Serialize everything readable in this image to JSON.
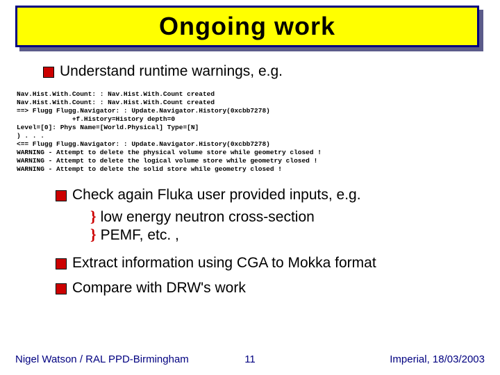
{
  "title": "Ongoing work",
  "bullets": {
    "b1": "Understand runtime warnings, e.g.",
    "b2": "Check again Fluka user provided inputs, e.g.",
    "b2a": "low energy neutron cross-section",
    "b2b": "PEMF, etc. ,",
    "b3": "Extract information using CGA to Mokka format",
    "b4": "Compare with DRW's work"
  },
  "code": "Nav.Hist.With.Count: : Nav.Hist.With.Count created\nNav.Hist.With.Count: : Nav.Hist.With.Count created\n==> Flugg Flugg.Navigator: : Update.Navigator.History(0xcbb7278)\n              +f.History=History depth=0\nLevel=[0]: Phys Name=[World.Physical] Type=[N]\n) . . .\n<== Flugg Flugg.Navigator: : Update.Navigator.History(0xcbb7278)\nWARNING - Attempt to delete the physical volume store while geometry closed !\nWARNING - Attempt to delete the logical volume store while geometry closed !\nWARNING - Attempt to delete the solid store while geometry closed !",
  "footer": {
    "left": "Nigel Watson / RAL PPD-Birmingham",
    "center": "11",
    "right": "Imperial, 18/03/2003"
  }
}
